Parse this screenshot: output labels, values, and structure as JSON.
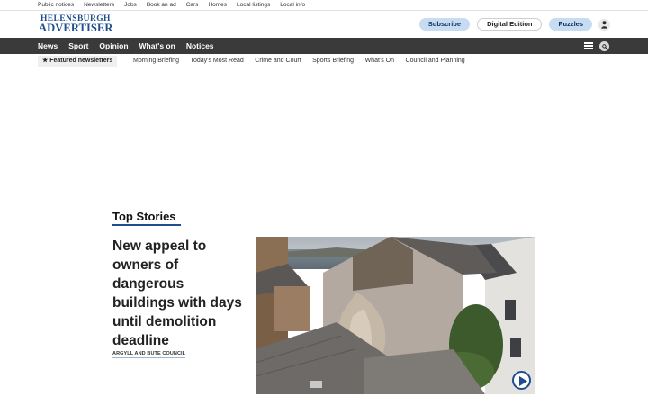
{
  "utility_links": [
    "Public notices",
    "Newsletters",
    "Jobs",
    "Book an ad",
    "Cars",
    "Homes",
    "Local listings",
    "Local info"
  ],
  "logo": {
    "line1": "HELENSBURGH",
    "line2": "ADVERTISER",
    "color": "#1f4e8c"
  },
  "header_actions": {
    "subscribe": "Subscribe",
    "digital_edition": "Digital Edition",
    "puzzles": "Puzzles"
  },
  "main_nav": [
    "News",
    "Sport",
    "Opinion",
    "What's on",
    "Notices"
  ],
  "featured_label": "★ Featured newsletters",
  "newsletters": [
    "Morning Briefing",
    "Today's Most Read",
    "Crime and Court",
    "Sports Briefing",
    "What's On",
    "Council and Planning"
  ],
  "top_stories": {
    "title": "Top Stories",
    "lead": {
      "headline": "New appeal to owners of dangerous buildings with days until demolition deadline",
      "tag": "ARGYLL AND BUTE COUNCIL",
      "image": "collapsed-building-photo",
      "has_video": true
    }
  },
  "colors": {
    "nav_bg": "#3a3a3a",
    "accent": "#1f4e8c",
    "pill_blue": "#c7dcf3"
  }
}
